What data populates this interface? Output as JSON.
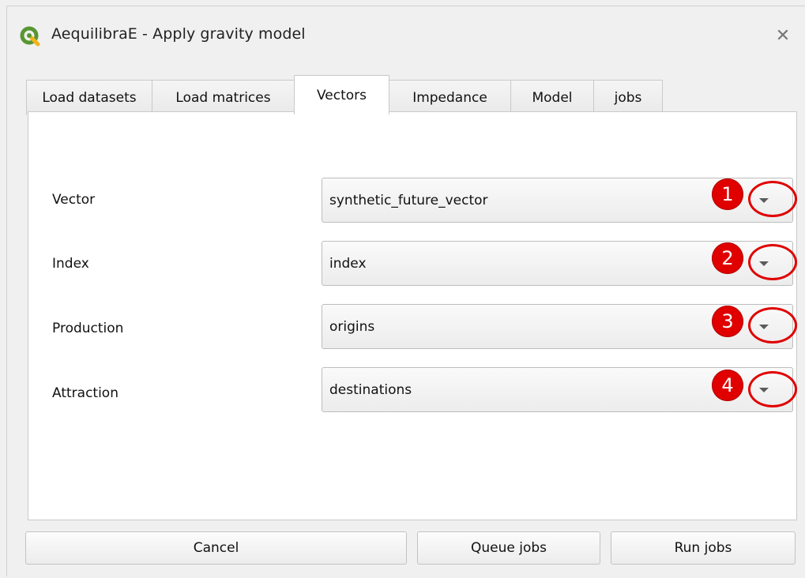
{
  "window": {
    "title": "AequilibraE - Apply gravity model",
    "app_icon": "qgis-icon",
    "close_glyph": "✕"
  },
  "tabs": [
    {
      "label": "Load datasets",
      "active": false
    },
    {
      "label": "Load matrices",
      "active": false
    },
    {
      "label": "Vectors",
      "active": true
    },
    {
      "label": "Impedance",
      "active": false
    },
    {
      "label": "Model",
      "active": false
    },
    {
      "label": "jobs",
      "active": false
    }
  ],
  "fields": [
    {
      "label": "Vector",
      "value": "synthetic_future_vector",
      "marker": "1"
    },
    {
      "label": "Index",
      "value": "index",
      "marker": "2"
    },
    {
      "label": "Production",
      "value": "origins",
      "marker": "3"
    },
    {
      "label": "Attraction",
      "value": "destinations",
      "marker": "4"
    }
  ],
  "buttons": {
    "cancel": "Cancel",
    "queue": "Queue jobs",
    "run": "Run jobs"
  },
  "colors": {
    "annotation_red": "#e00000",
    "qgis_green": "#589632",
    "qgis_yellow": "#f0b41c"
  }
}
